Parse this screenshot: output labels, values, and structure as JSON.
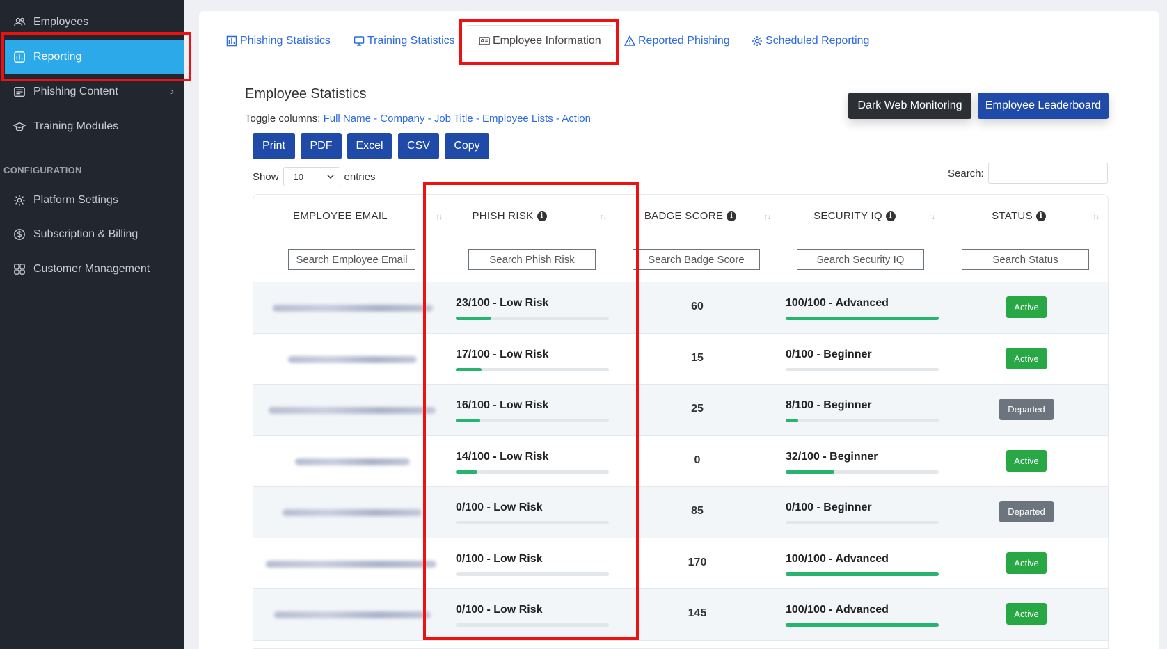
{
  "sidebar": {
    "items": [
      {
        "label": "Employees",
        "icon": "users-icon"
      },
      {
        "label": "Reporting",
        "icon": "chart-icon"
      },
      {
        "label": "Phishing Content",
        "icon": "content-icon"
      },
      {
        "label": "Training Modules",
        "icon": "graduation-icon"
      }
    ],
    "section_label": "CONFIGURATION",
    "config_items": [
      {
        "label": "Platform Settings",
        "icon": "gear-icon"
      },
      {
        "label": "Subscription & Billing",
        "icon": "dollar-icon"
      },
      {
        "label": "Customer Management",
        "icon": "grid-users-icon"
      }
    ],
    "chevron": "›"
  },
  "tabs": [
    {
      "label": "Phishing Statistics"
    },
    {
      "label": "Training Statistics"
    },
    {
      "label": "Employee Information"
    },
    {
      "label": "Reported Phishing"
    },
    {
      "label": "Scheduled Reporting"
    }
  ],
  "page": {
    "title": "Employee Statistics",
    "toggle_prefix": "Toggle columns:",
    "toggle_columns": [
      "Full Name",
      "Company",
      "Job Title",
      "Employee Lists",
      "Action"
    ],
    "toggle_sep": " - ",
    "dark_web_button": "Dark Web Monitoring",
    "leaderboard_button": "Employee Leaderboard",
    "export_buttons": [
      "Print",
      "PDF",
      "Excel",
      "CSV",
      "Copy"
    ],
    "show_label": "Show",
    "show_value": "10",
    "entries_label": "entries",
    "search_label": "Search:"
  },
  "table": {
    "headers": [
      "EMPLOYEE EMAIL",
      "PHISH RISK",
      "BADGE SCORE",
      "SECURITY IQ",
      "STATUS"
    ],
    "info_glyph": "i",
    "sort_glyph": "↑↓",
    "filters": [
      "Search Employee Email",
      "Search Phish Risk",
      "Search Badge Score",
      "Search Security IQ",
      "Search Status"
    ],
    "rows": [
      {
        "phish_risk": "23/100 - Low Risk",
        "phish_value": 23,
        "badge_score": "60",
        "security_iq": "100/100 - Advanced",
        "iq_value": 100,
        "status": "Active"
      },
      {
        "phish_risk": "17/100 - Low Risk",
        "phish_value": 17,
        "badge_score": "15",
        "security_iq": "0/100 - Beginner",
        "iq_value": 0,
        "status": "Active"
      },
      {
        "phish_risk": "16/100 - Low Risk",
        "phish_value": 16,
        "badge_score": "25",
        "security_iq": "8/100 - Beginner",
        "iq_value": 8,
        "status": "Departed"
      },
      {
        "phish_risk": "14/100 - Low Risk",
        "phish_value": 14,
        "badge_score": "0",
        "security_iq": "32/100 - Beginner",
        "iq_value": 32,
        "status": "Active"
      },
      {
        "phish_risk": "0/100 - Low Risk",
        "phish_value": 0,
        "badge_score": "85",
        "security_iq": "0/100 - Beginner",
        "iq_value": 0,
        "status": "Departed"
      },
      {
        "phish_risk": "0/100 - Low Risk",
        "phish_value": 0,
        "badge_score": "170",
        "security_iq": "100/100 - Advanced",
        "iq_value": 100,
        "status": "Active"
      },
      {
        "phish_risk": "0/100 - Low Risk",
        "phish_value": 0,
        "badge_score": "145",
        "security_iq": "100/100 - Advanced",
        "iq_value": 100,
        "status": "Active"
      }
    ]
  },
  "colors": {
    "sidebar_bg": "#22272f",
    "active_nav": "#2ba9e8",
    "primary": "#1f4aa8",
    "link": "#2d6be0",
    "success": "#28a745",
    "secondary": "#6c757d",
    "annotation_red": "#ee1111"
  }
}
